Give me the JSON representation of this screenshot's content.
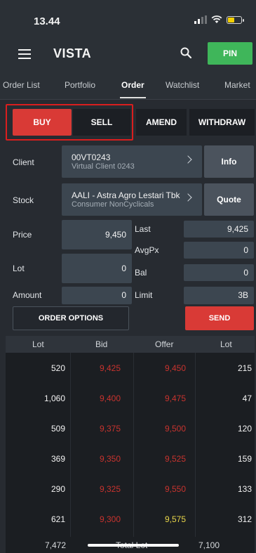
{
  "status_bar": {
    "time": "13.44"
  },
  "app": {
    "title": "VISTA",
    "pin_label": "PIN"
  },
  "tabs": [
    {
      "label": "Order List"
    },
    {
      "label": "Portfolio"
    },
    {
      "label": "Order",
      "active": true
    },
    {
      "label": "Watchlist"
    },
    {
      "label": "Market"
    }
  ],
  "mode_buttons": {
    "buy": "BUY",
    "sell": "SELL",
    "amend": "AMEND",
    "withdraw": "WITHDRAW"
  },
  "form": {
    "client_label": "Client",
    "client_code": "00VT0243",
    "client_name": "Virtual Client 0243",
    "info_button": "Info",
    "stock_label": "Stock",
    "stock_name": "AALI - Astra Agro Lestari Tbk",
    "stock_sector": "Consumer NonCyclicals",
    "quote_button": "Quote",
    "price_label": "Price",
    "price_value": "9,450",
    "lot_label": "Lot",
    "lot_value": "0",
    "amount_label": "Amount",
    "amount_value": "0",
    "last_label": "Last",
    "last_value": "9,425",
    "avgpx_label": "AvgPx",
    "avgpx_value": "0",
    "bal_label": "Bal",
    "bal_value": "0",
    "limit_label": "Limit",
    "limit_value": "3B",
    "order_options": "ORDER OPTIONS",
    "send": "SEND"
  },
  "orderbook": {
    "headers": {
      "lot": "Lot",
      "bid": "Bid",
      "offer": "Offer",
      "offer_lot": "Lot"
    },
    "rows": [
      {
        "bid_lot": "520",
        "bid": "9,425",
        "offer": "9,450",
        "offer_lot": "215"
      },
      {
        "bid_lot": "1,060",
        "bid": "9,400",
        "offer": "9,475",
        "offer_lot": "47"
      },
      {
        "bid_lot": "509",
        "bid": "9,375",
        "offer": "9,500",
        "offer_lot": "120"
      },
      {
        "bid_lot": "369",
        "bid": "9,350",
        "offer": "9,525",
        "offer_lot": "159"
      },
      {
        "bid_lot": "290",
        "bid": "9,325",
        "offer": "9,550",
        "offer_lot": "133"
      },
      {
        "bid_lot": "621",
        "bid": "9,300",
        "offer": "9,575",
        "offer_lot": "312"
      }
    ],
    "total_label": "Total Lot",
    "total_bid": "7,472",
    "total_offer": "7,100"
  },
  "colors": {
    "buy": "#d93a36",
    "pin": "#3fb65a",
    "bid_price": "#c8332e",
    "highlight_offer": "#e9d64a"
  }
}
